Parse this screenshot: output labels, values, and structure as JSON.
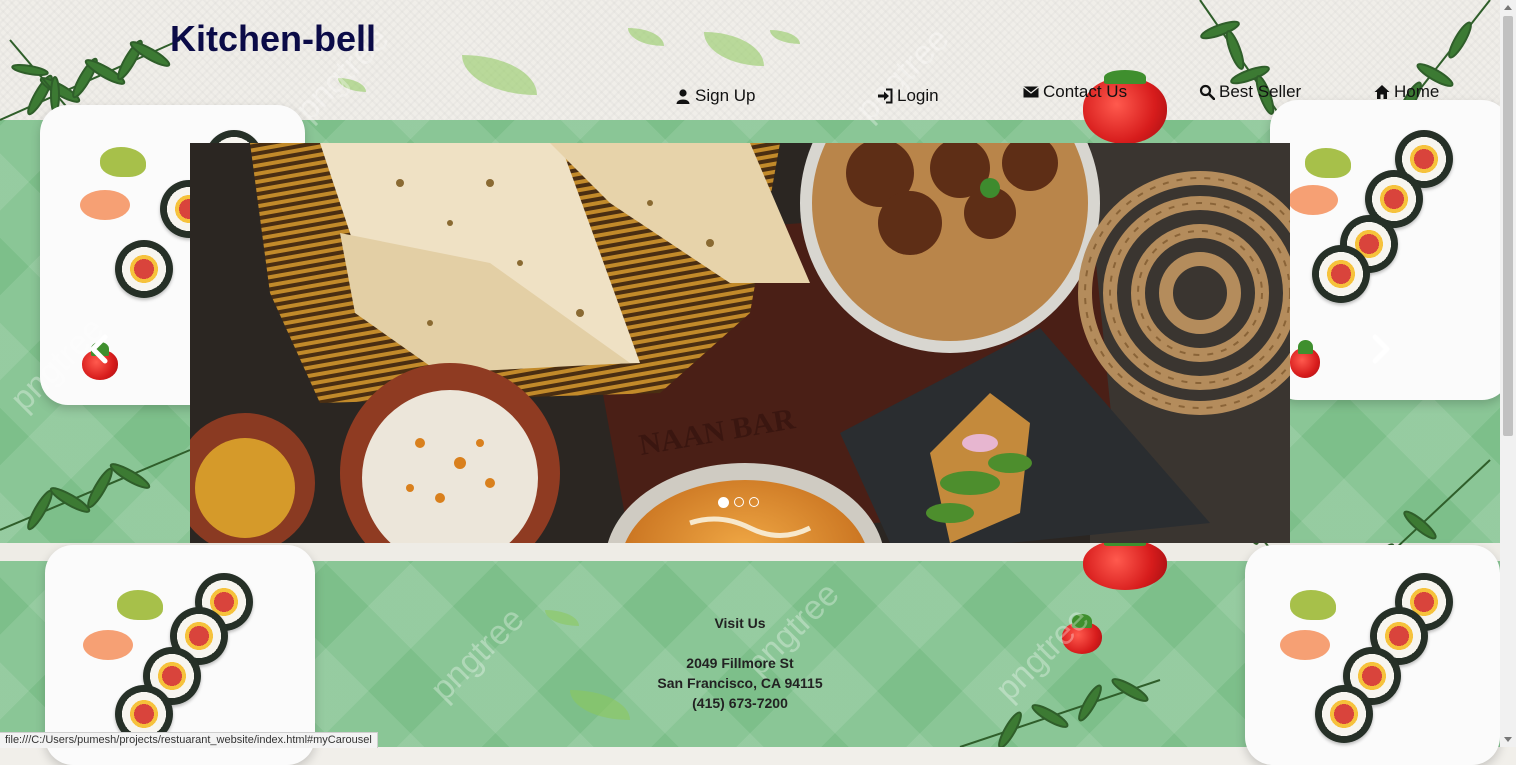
{
  "site": {
    "title": "Kitchen-bell"
  },
  "nav": {
    "items": [
      {
        "label": "Sign Up",
        "icon": "user-icon"
      },
      {
        "label": "Login",
        "icon": "login-icon"
      },
      {
        "label": "Contact Us",
        "icon": "envelope-icon"
      },
      {
        "label": "Best Seller",
        "icon": "search-icon"
      },
      {
        "label": "Home",
        "icon": "home-icon"
      }
    ]
  },
  "carousel": {
    "slide_text": "NAAN BAR",
    "indicators": 3,
    "active_indicator": 0,
    "prev_icon": "chevron-left-icon",
    "next_icon": "chevron-right-icon"
  },
  "footer": {
    "heading": "Visit Us",
    "address_line1": "2049 Fillmore St",
    "address_line2": "San Francisco, CA 94115",
    "phone": "(415) 673-7200"
  },
  "watermark": "pngtree",
  "status_bar": {
    "url": "file:///C:/Users/pumesh/projects/restuarant_website/index.html#myCarousel"
  },
  "colors": {
    "title": "#0b0b47",
    "background_green": "#7dbf8a",
    "background_top": "#f0eee9"
  }
}
